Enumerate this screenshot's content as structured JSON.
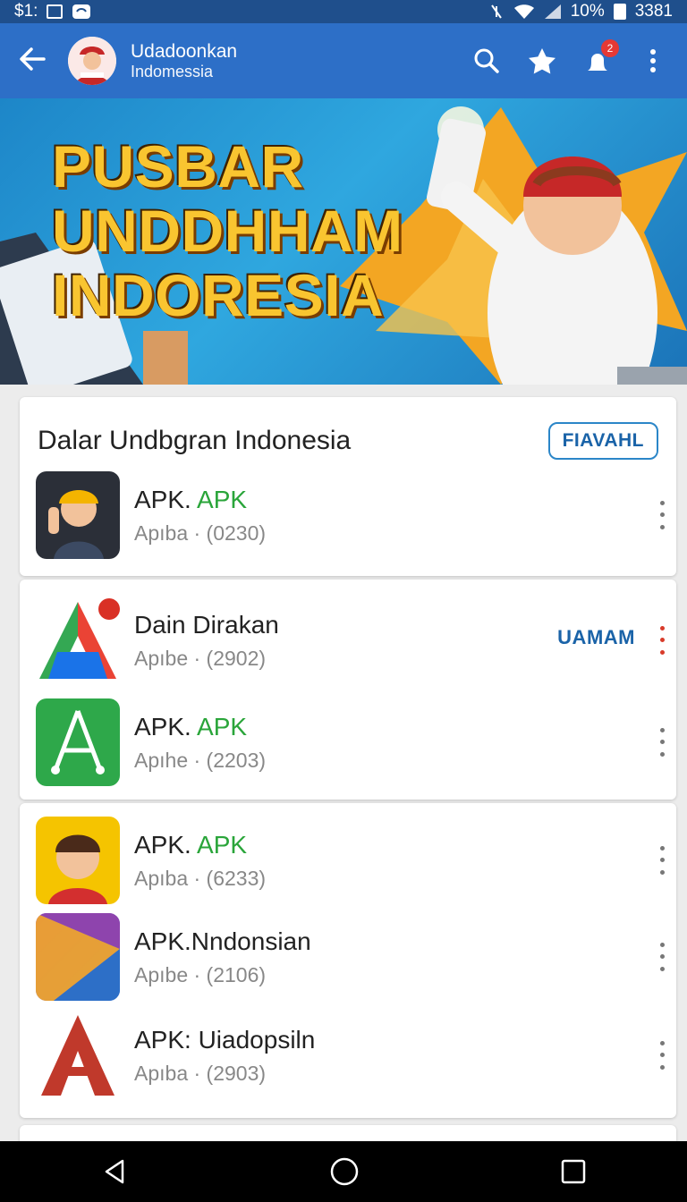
{
  "status": {
    "left": "$1:",
    "battery": "10%",
    "time": "3381"
  },
  "appbar": {
    "title": "Udadoonkan",
    "subtitle": "Indomessia"
  },
  "banner": {
    "lines": [
      "PUSBAR",
      "UNDDHHAM",
      "INDORESIA"
    ]
  },
  "section": {
    "title": "Dalar Undbgran Indonesia",
    "action": "FIAVAHL"
  },
  "notifications_badge": "2",
  "apps": [
    {
      "name_pre": "APK.",
      "name_post": "APK",
      "sub": "Apıba · (0230)"
    },
    {
      "name_pre": "Dain Dirakan",
      "name_post": "",
      "sub": "Apıbe · (2902)",
      "action": "UAMAM"
    },
    {
      "name_pre": "APK.",
      "name_post": "APK",
      "sub": "Apıhe · (2203)"
    },
    {
      "name_pre": "APK.",
      "name_post": "APK",
      "sub": "Apıba · (6233)"
    },
    {
      "name_pre": "APK.Nndonsian",
      "name_post": "",
      "sub": "Apıbe · (2106)"
    },
    {
      "name_pre": "APK: Uiadopsiln",
      "name_post": "",
      "sub": "Apıba · (2903)"
    }
  ],
  "colors": {
    "appbar": "#2d6fc7",
    "statusbar": "#1f4f8c",
    "accent_green": "#2aa53a",
    "action_blue": "#1a63a8"
  }
}
